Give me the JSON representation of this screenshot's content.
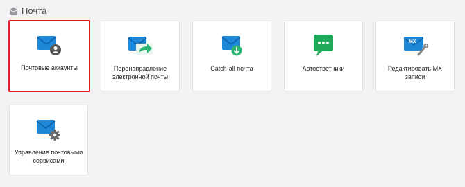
{
  "section": {
    "title": "Почта",
    "icon": "mail-section-icon"
  },
  "cards": [
    {
      "label": "Почтовые аккаунты",
      "icon": "mail-accounts-icon",
      "selected": true
    },
    {
      "label": "Перенаправление\nэлектронной почты",
      "icon": "mail-forward-icon",
      "selected": false
    },
    {
      "label": "Catch-all почта",
      "icon": "mail-catch-all-icon",
      "selected": false
    },
    {
      "label": "Автоответчики",
      "icon": "autoresponder-icon",
      "selected": false
    },
    {
      "label": "Редактировать MX\nзаписи",
      "icon": "mx-edit-icon",
      "selected": false
    },
    {
      "label": "Управление почтовыми\nсервисами",
      "icon": "mail-services-settings-icon",
      "selected": false
    }
  ],
  "colors": {
    "background": "#f2f2f4",
    "card": "#ffffff",
    "selected_border": "#e11d23",
    "mail_blue": "#1e88d8",
    "forward_green": "#2bb673",
    "chat_green": "#21a95a",
    "gear_gray": "#6b6b6b"
  },
  "icons": {
    "mx_text": "MX"
  }
}
